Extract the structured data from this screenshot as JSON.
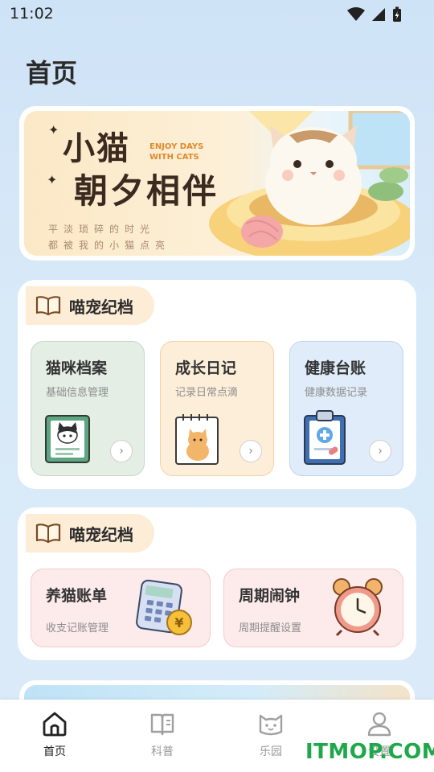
{
  "status_bar": {
    "time": "11:02"
  },
  "page": {
    "title": "首页"
  },
  "banner": {
    "title_line1": "小猫",
    "title_line2": "朝夕相伴",
    "english_line1": "ENJOY DAYS",
    "english_line2": "WITH CATS",
    "subtitle_line1": "平淡琐碎的时光",
    "subtitle_line2": "都被我的小猫点亮"
  },
  "section_archive": {
    "header": "喵宠纪档",
    "cards": [
      {
        "title": "猫咪档案",
        "subtitle": "基础信息管理",
        "icon": "cat-profile-card-icon"
      },
      {
        "title": "成长日记",
        "subtitle": "记录日常点滴",
        "icon": "cat-diary-notebook-icon"
      },
      {
        "title": "健康台账",
        "subtitle": "健康数据记录",
        "icon": "medical-clipboard-icon"
      }
    ]
  },
  "section_tools": {
    "header": "喵宠纪档",
    "cards": [
      {
        "title": "养猫账单",
        "subtitle": "收支记账管理",
        "icon": "calculator-coin-icon"
      },
      {
        "title": "周期闹钟",
        "subtitle": "周期提醒设置",
        "icon": "alarm-clock-icon"
      }
    ]
  },
  "tabbar": {
    "items": [
      {
        "label": "首页",
        "icon": "home-icon",
        "active": true
      },
      {
        "label": "科普",
        "icon": "book-icon",
        "active": false
      },
      {
        "label": "乐园",
        "icon": "cat-face-icon",
        "active": false
      },
      {
        "label": "设置",
        "icon": "user-icon",
        "active": false
      }
    ]
  },
  "watermark": {
    "text": "ITMOP.COM"
  },
  "colors": {
    "accent_orange": "#fdecd6",
    "card_green": "#e4eee4",
    "card_orange": "#fdeed9",
    "card_blue": "#e0ecf9",
    "card_pink": "#fdeaea",
    "watermark_green": "#1ea84a"
  }
}
